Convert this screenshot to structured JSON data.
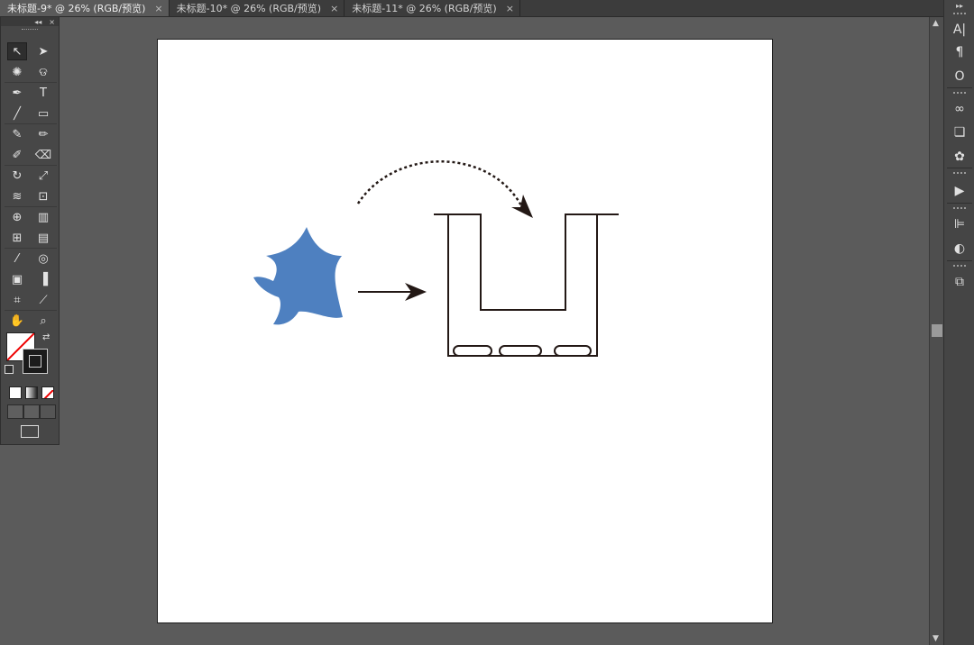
{
  "tabs": [
    {
      "label": "未标题-9* @ 26% (RGB/预览)",
      "close": "×",
      "active": true
    },
    {
      "label": "未标题-10* @ 26% (RGB/预览)",
      "close": "×",
      "active": false
    },
    {
      "label": "未标题-11* @ 26% (RGB/预览)",
      "close": "×",
      "active": false
    }
  ],
  "toolbox": {
    "collapse_glyph": "◂◂",
    "close_glyph": "×",
    "tools": [
      {
        "name": "selection-tool-icon",
        "glyph": "↖"
      },
      {
        "name": "direct-selection-tool-icon",
        "glyph": "➤"
      },
      {
        "name": "magic-wand-tool-icon",
        "glyph": "✺"
      },
      {
        "name": "lasso-tool-icon",
        "glyph": "ଡ"
      },
      {
        "name": "pen-tool-icon",
        "glyph": "✒"
      },
      {
        "name": "type-tool-icon",
        "glyph": "T"
      },
      {
        "name": "line-tool-icon",
        "glyph": "╱"
      },
      {
        "name": "rectangle-tool-icon",
        "glyph": "▭"
      },
      {
        "name": "paintbrush-tool-icon",
        "glyph": "✎"
      },
      {
        "name": "pencil-tool-icon",
        "glyph": "✏"
      },
      {
        "name": "blob-brush-tool-icon",
        "glyph": "✐"
      },
      {
        "name": "eraser-tool-icon",
        "glyph": "⌫"
      },
      {
        "name": "rotate-tool-icon",
        "glyph": "↻"
      },
      {
        "name": "scale-tool-icon",
        "glyph": "⤢"
      },
      {
        "name": "warp-tool-icon",
        "glyph": "≋"
      },
      {
        "name": "free-transform-tool-icon",
        "glyph": "⊡"
      },
      {
        "name": "shape-builder-tool-icon",
        "glyph": "⊕"
      },
      {
        "name": "perspective-grid-tool-icon",
        "glyph": "▥"
      },
      {
        "name": "mesh-tool-icon",
        "glyph": "⊞"
      },
      {
        "name": "gradient-tool-icon",
        "glyph": "▤"
      },
      {
        "name": "eyedropper-tool-icon",
        "glyph": "⁄"
      },
      {
        "name": "blend-tool-icon",
        "glyph": "◎"
      },
      {
        "name": "symbol-sprayer-tool-icon",
        "glyph": "▣"
      },
      {
        "name": "column-graph-tool-icon",
        "glyph": "▐"
      },
      {
        "name": "artboard-tool-icon",
        "glyph": "⌗"
      },
      {
        "name": "slice-tool-icon",
        "glyph": "⟋"
      },
      {
        "name": "hand-tool-icon",
        "glyph": "✋"
      },
      {
        "name": "zoom-tool-icon",
        "glyph": "⌕"
      }
    ]
  },
  "colors": {
    "shape_fill": "#4e80c0",
    "stroke": "#231815",
    "canvas": "#ffffff",
    "workspace": "#5b5b5b"
  },
  "right_panel": {
    "icons": [
      {
        "name": "character-panel-icon",
        "glyph": "A|"
      },
      {
        "name": "paragraph-panel-icon",
        "glyph": "¶"
      },
      {
        "name": "opentype-panel-icon",
        "glyph": "O"
      },
      {
        "name": "links-panel-icon",
        "glyph": "∞"
      },
      {
        "name": "image-trace-panel-icon",
        "glyph": "❏"
      },
      {
        "name": "symbols-panel-icon",
        "glyph": "✿"
      },
      {
        "name": "actions-panel-icon",
        "glyph": "▶"
      },
      {
        "name": "align-panel-icon",
        "glyph": "⊫"
      },
      {
        "name": "pathfinder-panel-icon",
        "glyph": "◐"
      },
      {
        "name": "transform-panel-icon",
        "glyph": "⧉"
      }
    ]
  }
}
